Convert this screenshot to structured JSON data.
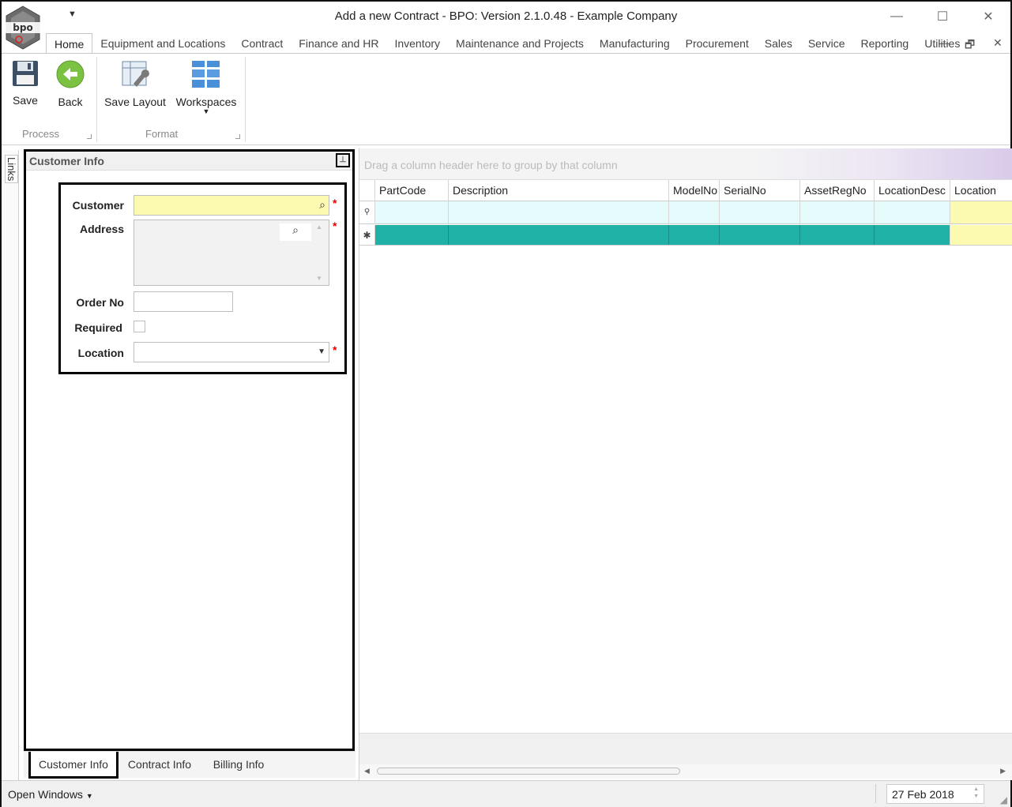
{
  "app": {
    "title": "Add a new Contract - BPO: Version 2.1.0.48 - Example Company",
    "logo_text": "bpo"
  },
  "tabs": [
    {
      "label": "Home",
      "active": true
    },
    {
      "label": "Equipment and Locations"
    },
    {
      "label": "Contract"
    },
    {
      "label": "Finance and HR"
    },
    {
      "label": "Inventory"
    },
    {
      "label": "Maintenance and Projects"
    },
    {
      "label": "Manufacturing"
    },
    {
      "label": "Procurement"
    },
    {
      "label": "Sales"
    },
    {
      "label": "Service"
    },
    {
      "label": "Reporting"
    },
    {
      "label": "Utilities"
    }
  ],
  "ribbon": {
    "save_label": "Save",
    "back_label": "Back",
    "save_layout_label": "Save Layout",
    "workspaces_label": "Workspaces",
    "process_group": "Process",
    "format_group": "Format"
  },
  "side": {
    "links_label": "Links"
  },
  "panel": {
    "title": "Customer Info",
    "fields": {
      "customer_label": "Customer",
      "address_label": "Address",
      "order_no_label": "Order No",
      "required_label": "Required",
      "location_label": "Location",
      "customer_value": "",
      "address_value": "",
      "order_no_value": "",
      "location_value": ""
    },
    "required_marker": "*"
  },
  "bottom_tabs": [
    {
      "label": "Customer Info",
      "active": true
    },
    {
      "label": "Contract Info"
    },
    {
      "label": "Billing Info"
    }
  ],
  "grid": {
    "group_hint": "Drag a column header here to group by that column",
    "columns": [
      "PartCode",
      "Description",
      "ModelNo",
      "SerialNo",
      "AssetRegNo",
      "LocationDesc",
      "Location"
    ]
  },
  "status": {
    "open_windows": "Open Windows",
    "date": "27 Feb 2018"
  },
  "colors": {
    "required_field": "#fbfab0",
    "new_row": "#1fb0a6",
    "filter_row": "#e6fbfc",
    "required_marker": "#e00000"
  }
}
